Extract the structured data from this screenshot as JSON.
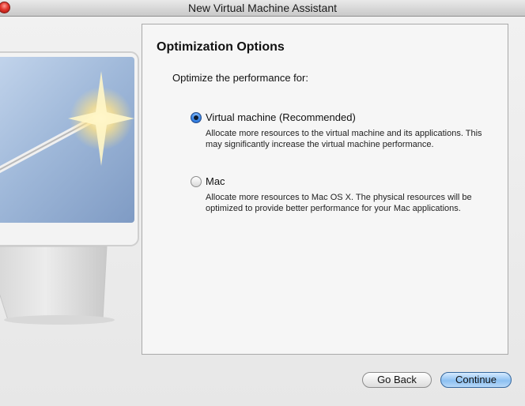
{
  "window": {
    "title": "New Virtual Machine Assistant"
  },
  "panel": {
    "heading": "Optimization Options",
    "prompt": "Optimize the performance for:",
    "options": [
      {
        "label": "Virtual machine (Recommended)",
        "description": "Allocate more resources to the virtual machine and its applications. This may significantly increase the virtual machine performance.",
        "selected": true
      },
      {
        "label": "Mac",
        "description": "Allocate more resources to Mac OS X. The physical resources will be optimized to provide better performance for your Mac applications.",
        "selected": false
      }
    ]
  },
  "footer": {
    "back_label": "Go Back",
    "continue_label": "Continue"
  },
  "colors": {
    "accent": "#3a86e8",
    "close_button": "#e2372d"
  }
}
